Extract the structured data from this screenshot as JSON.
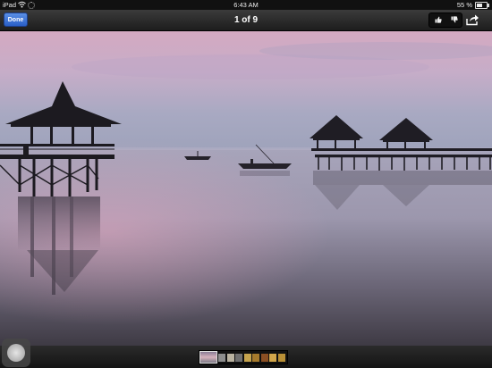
{
  "status_bar": {
    "carrier": "iPad",
    "wifi_icon": "wifi-icon",
    "activity_icon": "activity-spinner-icon",
    "time": "6:43 AM",
    "battery_text": "55 %",
    "battery_level": 0.55
  },
  "nav_bar": {
    "done_label": "Done",
    "title": "1 of 9",
    "thumbs_up_icon": "thumbs-up-icon",
    "thumbs_down_icon": "thumbs-down-icon",
    "share_icon": "share-icon"
  },
  "photo": {
    "subject": "pier-gazebos-at-dusk"
  },
  "filmstrip": {
    "current_index": 1,
    "total": 9,
    "thumb_colors": [
      "#c0a2b0",
      "#8d8d8d",
      "#b9b2a0",
      "#6f6f6f",
      "#c5a34d",
      "#a67a2c",
      "#8b4f23",
      "#d2a64a",
      "#b88f36"
    ]
  },
  "assistive_touch": {
    "icon": "assistive-touch-icon"
  }
}
